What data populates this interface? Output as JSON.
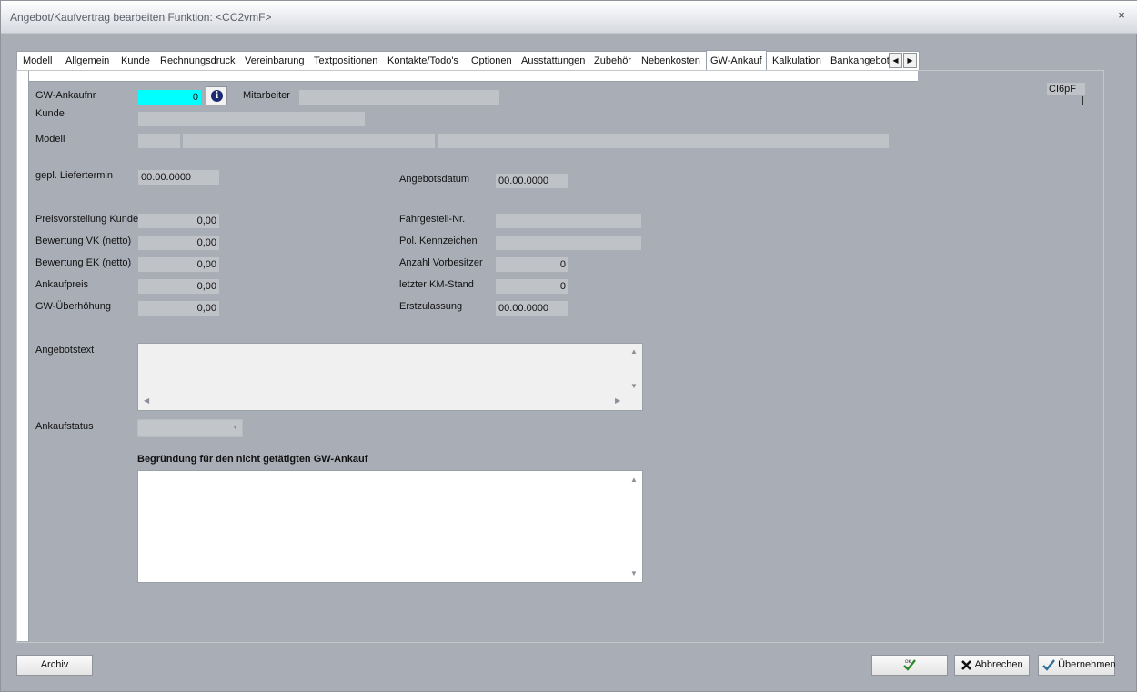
{
  "window": {
    "title": "Angebot/Kaufvertrag bearbeiten   Funktion: <CC2vmF>",
    "close_glyph": "×"
  },
  "tabs": [
    {
      "label": "Modell"
    },
    {
      "label": "Allgemein"
    },
    {
      "label": "Kunde"
    },
    {
      "label": "Rechnungsdruck"
    },
    {
      "label": "Vereinbarung"
    },
    {
      "label": "Textpositionen"
    },
    {
      "label": "Kontakte/Todo's"
    },
    {
      "label": "Optionen"
    },
    {
      "label": "Ausstattungen"
    },
    {
      "label": "Zubehör"
    },
    {
      "label": "Nebenkosten"
    },
    {
      "label": "GW-Ankauf",
      "active": true
    },
    {
      "label": "Kalkulation"
    },
    {
      "label": "Bankangebot"
    }
  ],
  "tab_scroll": {
    "left_glyph": "◀",
    "right_glyph": "▶"
  },
  "form": {
    "gw_ankaufnr_label": "GW-Ankaufnr",
    "gw_ankaufnr_value": "0",
    "info_glyph": "i",
    "mitarbeiter_label": "Mitarbeiter",
    "mitarbeiter_value": "",
    "kunde_label": "Kunde",
    "kunde_value": "",
    "modell_label": "Modell",
    "modell_values": [
      "",
      "",
      ""
    ],
    "gepl_liefertermin_label": "gepl. Liefertermin",
    "gepl_liefertermin_value": "00.00.0000",
    "angebotsdatum_label": "Angebotsdatum",
    "angebotsdatum_value": "00.00.0000",
    "preisvorstellung_label": "Preisvorstellung Kunde",
    "preisvorstellung_value": "0,00",
    "bewertung_vk_label": "Bewertung VK (netto)",
    "bewertung_vk_value": "0,00",
    "bewertung_ek_label": "Bewertung EK (netto)",
    "bewertung_ek_value": "0,00",
    "ankaufpreis_label": "Ankaufpreis",
    "ankaufpreis_value": "0,00",
    "gw_ueberhoehung_label": "GW-Überhöhung",
    "gw_ueberhoehung_value": "0,00",
    "fahrgestell_label": "Fahrgestell-Nr.",
    "fahrgestell_value": "",
    "kennzeichen_label": "Pol. Kennzeichen",
    "kennzeichen_value": "",
    "vorbesitzer_label": "Anzahl Vorbesitzer",
    "vorbesitzer_value": "0",
    "km_stand_label": "letzter KM-Stand",
    "km_stand_value": "0",
    "erstzulassung_label": "Erstzulassung",
    "erstzulassung_value": "00.00.0000",
    "angebotstext_label": "Angebotstext",
    "angebotstext_value": "",
    "ankaufstatus_label": "Ankaufstatus",
    "ankaufstatus_value": "",
    "begruendung_label": "Begründung für den nicht getätigten GW-Ankauf",
    "begruendung_value": "",
    "ci6pf_value": "CI6pF"
  },
  "buttons": {
    "archiv": "Archiv",
    "ok_icon_text": "OK",
    "abbrechen": "Abbrechen",
    "uebernehmen": "Übernehmen"
  },
  "colors": {
    "background": "#a9adb6",
    "field": "#bfc2c7",
    "highlight_field": "#00ffff",
    "info_icon": "#1d2a72"
  }
}
